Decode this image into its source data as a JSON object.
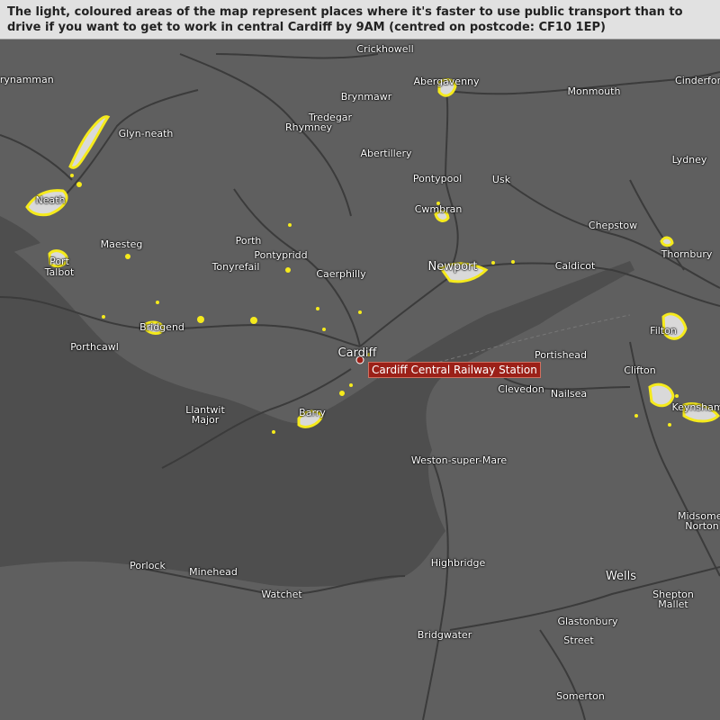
{
  "header": {
    "text": "The light, coloured areas of the map represent places where it's faster to use public transport than to drive if you want to get to work in central Cardiff by 9AM (centred on postcode: CF10 1EP)"
  },
  "station": {
    "label": "Cardiff Central Railway Station"
  },
  "towns": {
    "crickhowell": "Crickhowell",
    "brynamman": "Brynamman",
    "abergavenny": "Abergavenny",
    "monmouth": "Monmouth",
    "cinderford": "Cinderford",
    "brynmawr": "Brynmawr",
    "tredegar": "Tredegar",
    "rhymney": "Rhymney",
    "glynneath": "Glyn-neath",
    "abertillery": "Abertillery",
    "lydney": "Lydney",
    "pontypool": "Pontypool",
    "usk": "Usk",
    "neath": "Neath",
    "cwmbran": "Cwmbran",
    "chepstow": "Chepstow",
    "maesteg": "Maesteg",
    "porth": "Porth",
    "pontypridd": "Pontypridd",
    "tonyrefail": "Tonyrefail",
    "port_talbot": "Port\nTalbot",
    "thornbury": "Thornbury",
    "newport": "Newport",
    "caldicot": "Caldicot",
    "caerphilly": "Caerphilly",
    "bridgend": "Bridgend",
    "filton": "Filton",
    "porthcawl": "Porthcawl",
    "cardiff": "Cardiff",
    "portishead": "Portishead",
    "clifton": "Clifton",
    "clevedon": "Clevedon",
    "nailsea": "Nailsea",
    "llantwit_major": "Llantwit\nMajor",
    "barry": "Barry",
    "keynsham": "Keynsham",
    "weston": "Weston-super-Mare",
    "midsomer_norton": "Midsomer\nNorton",
    "porlock": "Porlock",
    "minehead": "Minehead",
    "highbridge": "Highbridge",
    "wells": "Wells",
    "watchet": "Watchet",
    "shepton_mallet": "Shepton\nMallet",
    "glastonbury": "Glastonbury",
    "bridgwater": "Bridgwater",
    "street": "Street",
    "somerton": "Somerton"
  },
  "colors": {
    "land": "#5f5f5f",
    "sea": "#4d4d4d",
    "road": "#3a3a3a",
    "highlight_outline": "#f5ea1c",
    "highlight_fill": "#d9d9d9",
    "station": "#9b2018"
  }
}
